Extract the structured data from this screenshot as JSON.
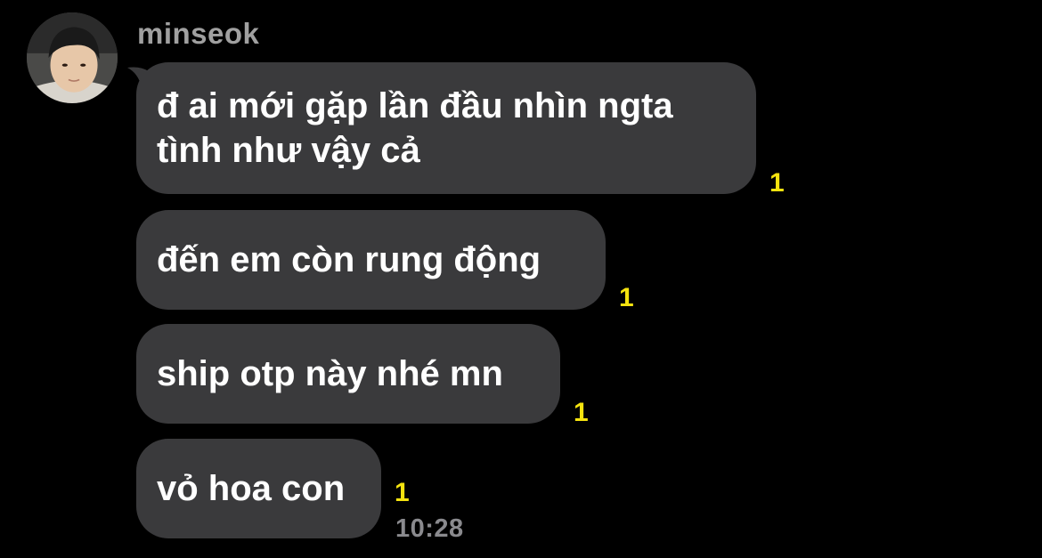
{
  "sender": {
    "name": "minseok",
    "avatar": "profile-photo"
  },
  "messages": [
    {
      "lines": [
        "đ ai mới gặp lần đầu nhìn ngta",
        "tình như vậy cả"
      ],
      "unread": "1"
    },
    {
      "lines": [
        "đến em còn rung động"
      ],
      "unread": "1"
    },
    {
      "lines": [
        "ship otp này nhé mn"
      ],
      "unread": "1"
    },
    {
      "lines": [
        "vỏ hoa con"
      ],
      "unread": "1"
    }
  ],
  "timestamp": "10:28",
  "colors": {
    "background": "#000000",
    "bubble": "#3a3a3c",
    "message_text": "#ffffff",
    "unread_count": "#f5e30f",
    "sender_name": "#a0a0a0",
    "timestamp": "#8a8a8e"
  }
}
